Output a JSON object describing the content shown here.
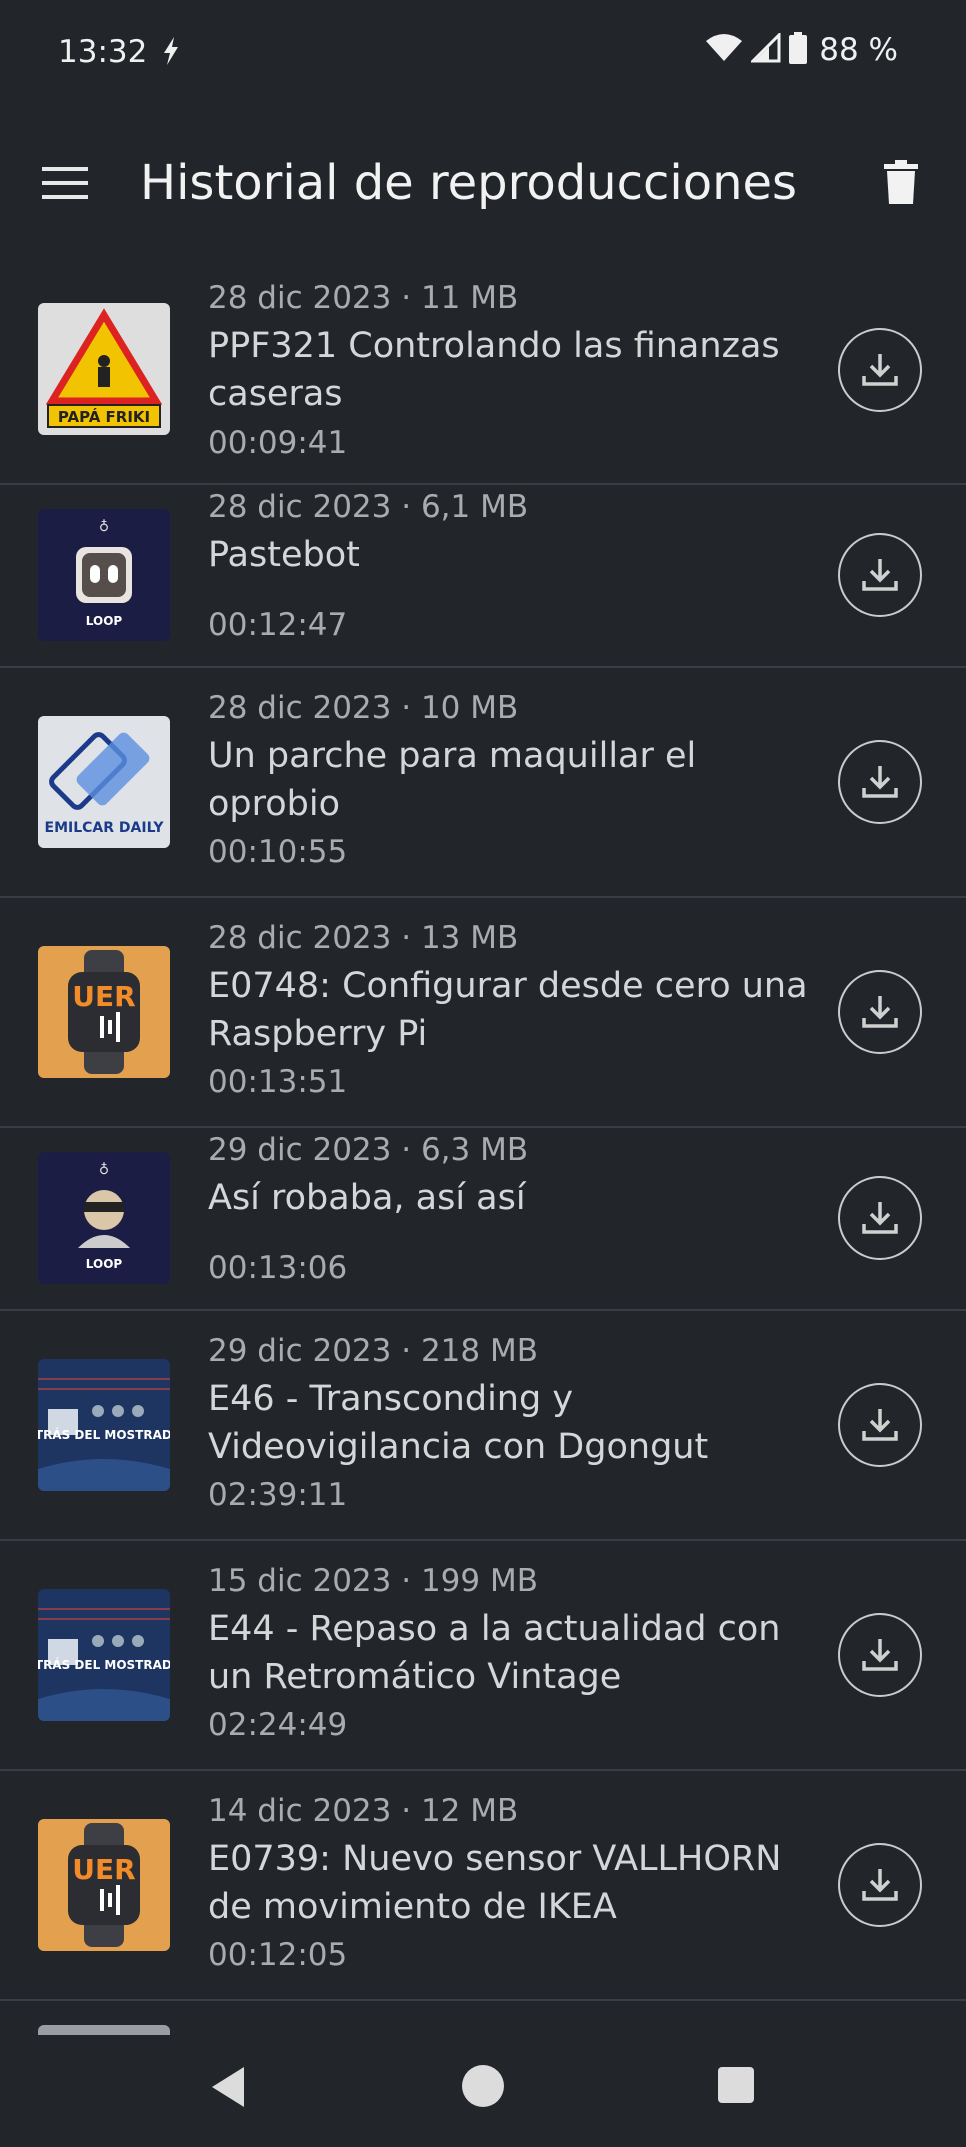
{
  "status_bar": {
    "time": "13:32",
    "battery": "88 %"
  },
  "app_bar": {
    "title": "Historial de reproducciones",
    "menu_icon": "hamburger-menu-icon",
    "delete_icon": "trash-icon"
  },
  "items": [
    {
      "meta": "28 dic 2023 · 11 MB",
      "title": "PPF321 Controlando las finanzas caseras",
      "duration": "00:09:41",
      "thumb": "papa-friki",
      "thumb_text": "PAPÁ FRIKI"
    },
    {
      "meta": "28 dic 2023 · 6,1 MB",
      "title": "Pastebot",
      "duration": "00:12:47",
      "thumb": "loop-infinito-robot",
      "thumb_text": "LOOP"
    },
    {
      "meta": "28 dic 2023 · 10 MB",
      "title": "Un parche para maquillar el oprobio",
      "duration": "00:10:55",
      "thumb": "emilcar-daily",
      "thumb_text": "EMILCAR DAILY"
    },
    {
      "meta": "28 dic 2023 · 13 MB",
      "title": "E0748: Configurar desde cero una Raspberry Pi",
      "duration": "00:13:51",
      "thumb": "uer-watch",
      "thumb_text": "UER"
    },
    {
      "meta": "29 dic 2023 · 6,3 MB",
      "title": "Así robaba, así así",
      "duration": "00:13:06",
      "thumb": "loop-infinito-thief",
      "thumb_text": "LOOP"
    },
    {
      "meta": "29 dic 2023 · 218 MB",
      "title": "E46 - Transconding y Videovigilancia con Dgongut",
      "duration": "02:39:11",
      "thumb": "detras-del-mostrador",
      "thumb_text": "DETRÁS DEL MOSTRADOR"
    },
    {
      "meta": "15 dic 2023 · 199 MB",
      "title": "E44 - Repaso a la actualidad con un Retromático Vintage",
      "duration": "02:24:49",
      "thumb": "detras-del-mostrador",
      "thumb_text": "DETRÁS DEL MOSTRADOR"
    },
    {
      "meta": "14 dic 2023 · 12 MB",
      "title": "E0739: Nuevo sensor VALLHORN de movimiento de IKEA",
      "duration": "00:12:05",
      "thumb": "uer-watch",
      "thumb_text": "UER"
    }
  ],
  "colors": {
    "background": "#22262b",
    "divider": "#3a3e44",
    "text_primary": "#d5d6d8",
    "text_secondary": "#a9abae"
  }
}
